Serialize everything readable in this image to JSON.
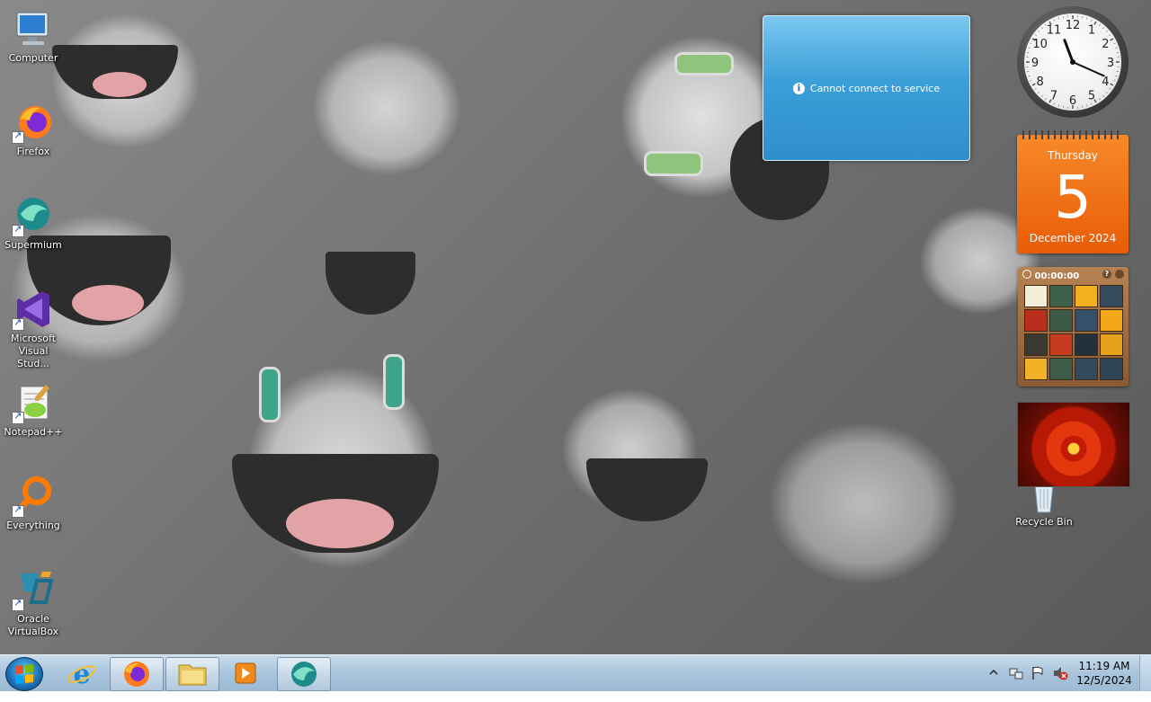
{
  "desktop_icons": [
    {
      "label": "Computer",
      "icon": "computer-icon"
    },
    {
      "label": "Firefox",
      "icon": "firefox-icon"
    },
    {
      "label": "Supermium",
      "icon": "supermium-icon"
    },
    {
      "label": "Microsoft Visual Stud...",
      "icon": "visual-studio-icon"
    },
    {
      "label": "Notepad++",
      "icon": "notepad-plus-plus-icon"
    },
    {
      "label": "Everything",
      "icon": "everything-search-icon"
    },
    {
      "label": "Oracle VirtualBox",
      "icon": "virtualbox-icon"
    },
    {
      "label": "Recycle Bin",
      "icon": "recycle-bin-icon"
    }
  ],
  "notification": {
    "text": "Cannot connect to service",
    "icon": "info-icon"
  },
  "gadgets": {
    "clock": {
      "hour": 11,
      "minute": 19,
      "numerals": [
        "12",
        "1",
        "2",
        "3",
        "4",
        "5",
        "6",
        "7",
        "8",
        "9",
        "10",
        "11"
      ]
    },
    "calendar": {
      "weekday": "Thursday",
      "day": "5",
      "month_year": "December 2024"
    },
    "puzzle": {
      "timer": "00:00:00",
      "help_label": "?"
    },
    "slideshow": {
      "subject": "orange chrysanthemum flower"
    }
  },
  "taskbar": {
    "items": [
      {
        "name": "internet-explorer",
        "icon": "internet-explorer-icon",
        "pinned": false
      },
      {
        "name": "firefox",
        "icon": "firefox-icon",
        "pinned": true
      },
      {
        "name": "file-explorer",
        "icon": "folder-icon",
        "pinned": true
      },
      {
        "name": "media-player",
        "icon": "media-player-icon",
        "pinned": false
      },
      {
        "name": "supermium",
        "icon": "supermium-icon",
        "pinned": true
      }
    ],
    "tray": {
      "time": "11:19 AM",
      "date": "12/5/2024",
      "icons": [
        "show-hidden-icons-arrow",
        "network-icon",
        "action-center-flag-icon",
        "volume-muted-icon"
      ]
    }
  },
  "colors": {
    "taskbar": "#a9c4dc",
    "notification": "#3b9fd8",
    "calendar": "#e85c08",
    "wallpaper": "#8a8a8a"
  }
}
